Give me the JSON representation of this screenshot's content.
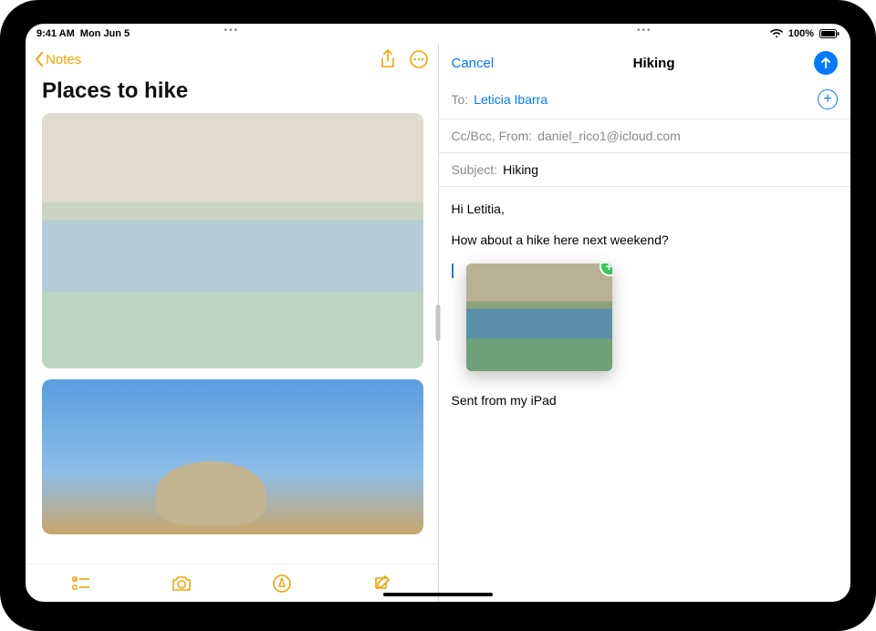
{
  "statusbar": {
    "time": "9:41 AM",
    "date": "Mon Jun 5",
    "battery": "100%"
  },
  "notes": {
    "back_label": "Notes",
    "title": "Places to hike"
  },
  "mail": {
    "cancel_label": "Cancel",
    "title": "Hiking",
    "to_label": "To:",
    "to_value": "Leticia Ibarra",
    "ccbcc_label": "Cc/Bcc, From:",
    "from_value": "daniel_rico1@icloud.com",
    "subject_label": "Subject:",
    "subject_value": "Hiking",
    "body_greeting": "Hi Letitia,",
    "body_line": "How about a hike here next weekend?",
    "signature": "Sent from my iPad"
  },
  "icons": {
    "multitask": "•••"
  }
}
